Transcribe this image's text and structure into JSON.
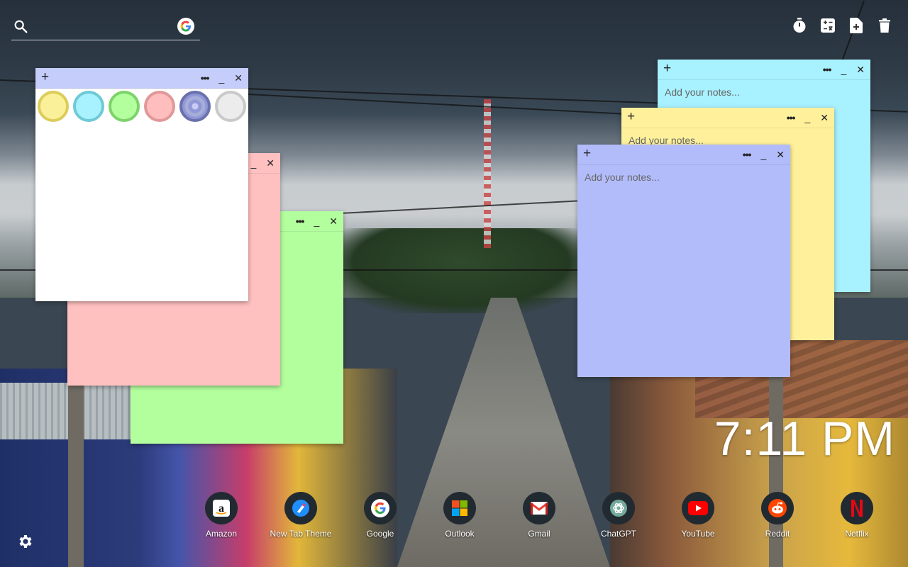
{
  "search": {
    "placeholder": ""
  },
  "toolbar": {
    "icons": [
      "timer-icon",
      "calculator-icon",
      "add-note-icon",
      "trash-icon"
    ]
  },
  "notes": {
    "add_symbol": "+",
    "menu_symbol": "•••",
    "minimize_symbol": "_",
    "close_symbol": "✕",
    "placeholder": "Add your notes...",
    "colors": {
      "white": "#ffffff",
      "pink": "#ffc0c0",
      "green": "#b3ff9e",
      "cyan": "#a8f1ff",
      "yellow": "#fff19b",
      "blue": "#b3bcfa"
    },
    "swatch_colors": [
      {
        "name": "yellow",
        "fill": "#fbf09a",
        "ring": "#dccc5a"
      },
      {
        "name": "cyan",
        "fill": "#a8f1ff",
        "ring": "#6ecad6"
      },
      {
        "name": "green",
        "fill": "#b3ff9e",
        "ring": "#7dd36a"
      },
      {
        "name": "pink",
        "fill": "#ffbdbd",
        "ring": "#e09898"
      },
      {
        "name": "blue",
        "fill": "#8f97d6",
        "ring": "#6a71ad"
      },
      {
        "name": "white",
        "fill": "#ececec",
        "ring": "#c9c9c9"
      }
    ]
  },
  "clock": {
    "time": "7:11 PM"
  },
  "shortcuts": [
    {
      "label": "Amazon",
      "icon": "amazon-icon"
    },
    {
      "label": "New Tab Theme",
      "icon": "new-tab-theme-icon"
    },
    {
      "label": "Google",
      "icon": "google-icon"
    },
    {
      "label": "Outlook",
      "icon": "microsoft-icon"
    },
    {
      "label": "Gmail",
      "icon": "gmail-icon"
    },
    {
      "label": "ChatGPT",
      "icon": "chatgpt-icon"
    },
    {
      "label": "YouTube",
      "icon": "youtube-icon"
    },
    {
      "label": "Reddit",
      "icon": "reddit-icon"
    },
    {
      "label": "Netflix",
      "icon": "netflix-icon"
    }
  ]
}
